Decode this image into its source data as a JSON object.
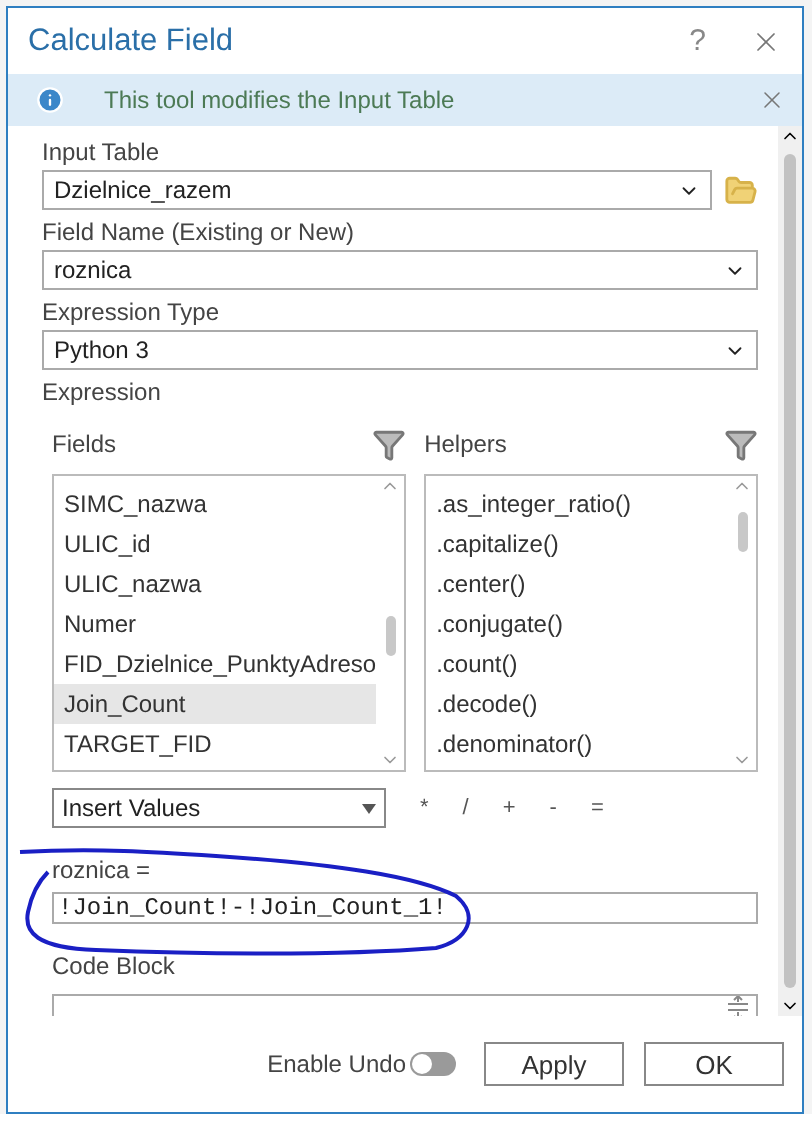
{
  "window": {
    "title": "Calculate Field",
    "help": "?"
  },
  "info": {
    "message": "This tool modifies the Input Table"
  },
  "input_table": {
    "label": "Input Table",
    "value": "Dzielnice_razem"
  },
  "field_name": {
    "label": "Field Name (Existing or New)",
    "value": "roznica"
  },
  "expression_type": {
    "label": "Expression Type",
    "value": "Python 3"
  },
  "expression": {
    "label": "Expression",
    "fields": {
      "label": "Fields",
      "items": [
        {
          "name": "SIMC_nazwa",
          "selected": false
        },
        {
          "name": "ULIC_id",
          "selected": false
        },
        {
          "name": "ULIC_nazwa",
          "selected": false
        },
        {
          "name": "Numer",
          "selected": false
        },
        {
          "name": "FID_Dzielnice_PunktyAdreso",
          "selected": false
        },
        {
          "name": "Join_Count",
          "selected": true
        },
        {
          "name": "TARGET_FID",
          "selected": false
        }
      ]
    },
    "helpers": {
      "label": "Helpers",
      "items": [
        ".as_integer_ratio()",
        ".capitalize()",
        ".center()",
        ".conjugate()",
        ".count()",
        ".decode()",
        ".denominator()"
      ]
    },
    "insert": "Insert Values",
    "operators": [
      "*",
      "/",
      "+",
      "-",
      "="
    ],
    "target_label": "roznica =",
    "value": "!Join_Count!-!Join_Count_1!"
  },
  "code_block": {
    "label": "Code Block"
  },
  "enable_undo": {
    "label": "Enable Undo",
    "on": false
  },
  "buttons": [
    "Apply",
    "OK"
  ]
}
